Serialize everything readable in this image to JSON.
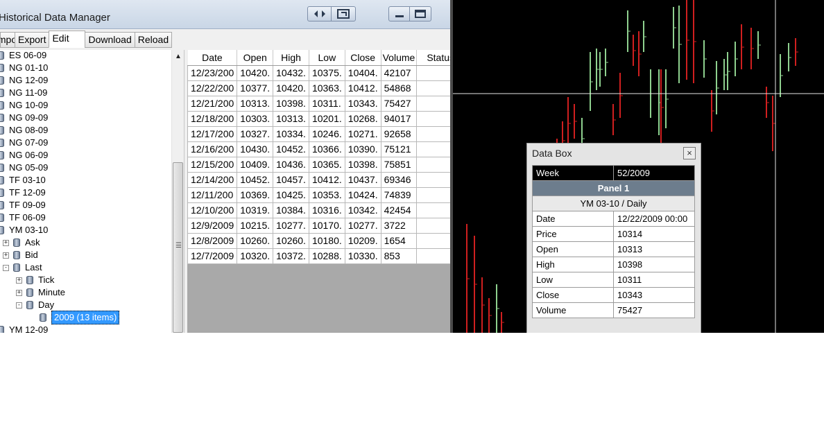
{
  "window": {
    "title": "Historical Data Manager"
  },
  "toolbar": {
    "buttons": [
      "Import",
      "Export",
      "Edit",
      "Download",
      "Reload"
    ],
    "selected": "Edit"
  },
  "tree": {
    "items": [
      {
        "label": "ES 06-09",
        "level": 0,
        "expander": ""
      },
      {
        "label": "NG 01-10",
        "level": 0,
        "expander": ""
      },
      {
        "label": "NG 12-09",
        "level": 0,
        "expander": ""
      },
      {
        "label": "NG 11-09",
        "level": 0,
        "expander": ""
      },
      {
        "label": "NG 10-09",
        "level": 0,
        "expander": ""
      },
      {
        "label": "NG 09-09",
        "level": 0,
        "expander": ""
      },
      {
        "label": "NG 08-09",
        "level": 0,
        "expander": ""
      },
      {
        "label": "NG 07-09",
        "level": 0,
        "expander": ""
      },
      {
        "label": "NG 06-09",
        "level": 0,
        "expander": ""
      },
      {
        "label": "NG 05-09",
        "level": 0,
        "expander": ""
      },
      {
        "label": "TF 03-10",
        "level": 0,
        "expander": ""
      },
      {
        "label": "TF 12-09",
        "level": 0,
        "expander": ""
      },
      {
        "label": "TF 09-09",
        "level": 0,
        "expander": ""
      },
      {
        "label": "TF 06-09",
        "level": 0,
        "expander": ""
      },
      {
        "label": "YM 03-10",
        "level": 0,
        "expander": ""
      },
      {
        "label": "Ask",
        "level": 1,
        "expander": "+"
      },
      {
        "label": "Bid",
        "level": 1,
        "expander": "+"
      },
      {
        "label": "Last",
        "level": 1,
        "expander": "-"
      },
      {
        "label": "Tick",
        "level": 2,
        "expander": "+"
      },
      {
        "label": "Minute",
        "level": 2,
        "expander": "+"
      },
      {
        "label": "Day",
        "level": 2,
        "expander": "-"
      },
      {
        "label": "2009 (13 items)",
        "level": 3,
        "expander": "",
        "selected": true
      },
      {
        "label": "YM 12-09",
        "level": 0,
        "expander": ""
      }
    ]
  },
  "grid": {
    "columns": [
      "Date",
      "Open",
      "High",
      "Low",
      "Close",
      "Volume",
      "Status"
    ],
    "rows": [
      [
        "12/23/200",
        "10420.",
        "10432.",
        "10375.",
        "10404.",
        "42107",
        ""
      ],
      [
        "12/22/200",
        "10377.",
        "10420.",
        "10363.",
        "10412.",
        "54868",
        ""
      ],
      [
        "12/21/200",
        "10313.",
        "10398.",
        "10311.",
        "10343.",
        "75427",
        ""
      ],
      [
        "12/18/200",
        "10303.",
        "10313.",
        "10201.",
        "10268.",
        "94017",
        ""
      ],
      [
        "12/17/200",
        "10327.",
        "10334.",
        "10246.",
        "10271.",
        "92658",
        ""
      ],
      [
        "12/16/200",
        "10430.",
        "10452.",
        "10366.",
        "10390.",
        "75121",
        ""
      ],
      [
        "12/15/200",
        "10409.",
        "10436.",
        "10365.",
        "10398.",
        "75851",
        ""
      ],
      [
        "12/14/200",
        "10452.",
        "10457.",
        "10412.",
        "10437.",
        "69346",
        ""
      ],
      [
        "12/11/200",
        "10369.",
        "10425.",
        "10353.",
        "10424.",
        "74839",
        ""
      ],
      [
        "12/10/200",
        "10319.",
        "10384.",
        "10316.",
        "10342.",
        "42454",
        ""
      ],
      [
        "12/9/2009",
        "10215.",
        "10277.",
        "10170.",
        "10277.",
        "3722",
        ""
      ],
      [
        "12/8/2009",
        "10260.",
        "10260.",
        "10180.",
        "10209.",
        "1654",
        ""
      ],
      [
        "12/7/2009",
        "10320.",
        "10372.",
        "10288.",
        "10330.",
        "853",
        ""
      ]
    ]
  },
  "databox": {
    "title": "Data Box",
    "close_glyph": "×",
    "week_label": "Week",
    "week_value": "52/2009",
    "panel": "Panel 1",
    "instrument": "YM 03-10 / Daily",
    "fields": [
      {
        "k": "Date",
        "v": "12/22/2009 00:00"
      },
      {
        "k": "Price",
        "v": "10314"
      },
      {
        "k": "Open",
        "v": "10313"
      },
      {
        "k": "High",
        "v": "10398"
      },
      {
        "k": "Low",
        "v": "10311"
      },
      {
        "k": "Close",
        "v": "10343"
      },
      {
        "k": "Volume",
        "v": "75427"
      }
    ]
  },
  "colors": {
    "chart_bg": "#000000",
    "up_bar": "#8fd18f",
    "down_bar": "#d01f1f",
    "crosshair": "#e6e6e6",
    "selection": "#3399ff"
  },
  "icons": {
    "tree_node": "database-icon",
    "titlebar": [
      "arrows-icon",
      "dock-icon",
      "minimize-icon",
      "maximize-icon"
    ]
  }
}
